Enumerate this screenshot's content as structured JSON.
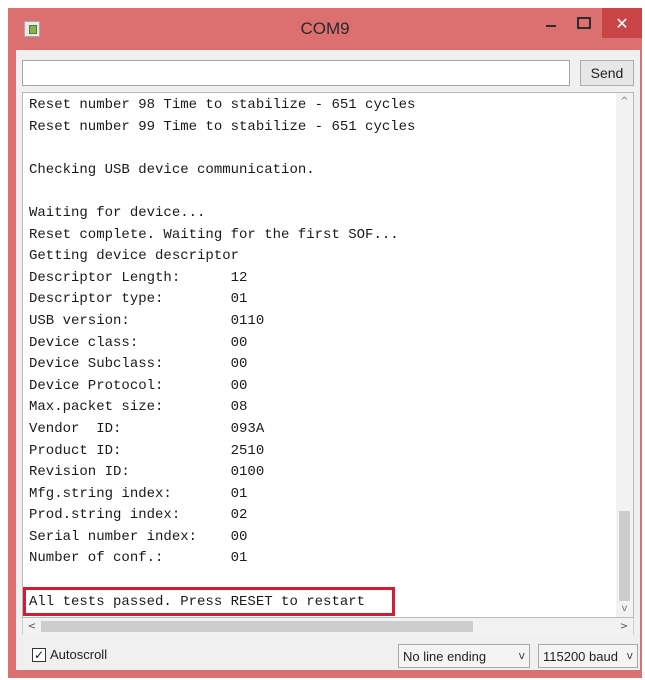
{
  "window": {
    "title": "COM9",
    "close_glyph": "✕"
  },
  "toolbar": {
    "send_input_value": "",
    "send_label": "Send"
  },
  "console": {
    "lines": [
      "Reset number 98 Time to stabilize - 651 cycles",
      "Reset number 99 Time to stabilize - 651 cycles",
      "",
      "Checking USB device communication.",
      "",
      "Waiting for device...",
      "Reset complete. Waiting for the first SOF...",
      "Getting device descriptor",
      "Descriptor Length:      12",
      "Descriptor type:        01",
      "USB version:            0110",
      "Device class:           00",
      "Device Subclass:        00",
      "Device Protocol:        00",
      "Max.packet size:        08",
      "Vendor  ID:             093A",
      "Product ID:             2510",
      "Revision ID:            0100",
      "Mfg.string index:       01",
      "Prod.string index:      02",
      "Serial number index:    00",
      "Number of conf.:        01",
      "",
      "All tests passed. Press RESET to restart"
    ]
  },
  "scroll": {
    "up": "^",
    "down": "v",
    "left": "<",
    "right": ">"
  },
  "status": {
    "autoscroll_label": "Autoscroll",
    "autoscroll_checked": true,
    "check_glyph": "✓",
    "line_ending": "No line ending",
    "baud": "115200 baud",
    "caret": "v"
  },
  "colors": {
    "title_bar": "#dc6f70",
    "close_button": "#c94446",
    "highlight_border": "#d11d33",
    "console_bg": "#ffffff"
  },
  "icons": [
    "app-icon",
    "minimize-icon",
    "maximize-icon",
    "close-icon",
    "check-icon",
    "chevron-down-icon"
  ]
}
